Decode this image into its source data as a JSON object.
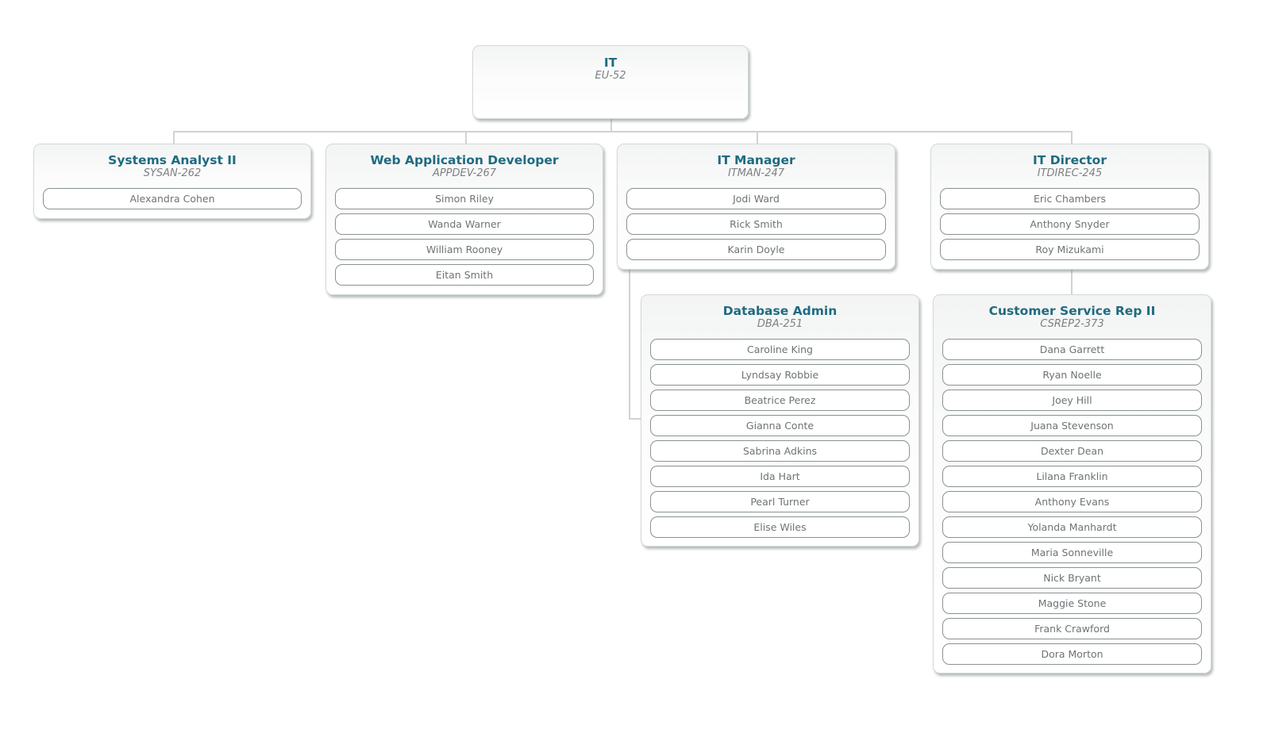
{
  "root": {
    "title": "IT",
    "code": "EU-52"
  },
  "positions": [
    {
      "title": "Systems Analyst II",
      "code": "SYSAN-262",
      "people": [
        "Alexandra Cohen"
      ]
    },
    {
      "title": "Web Application Developer",
      "code": "APPDEV-267",
      "people": [
        "Simon Riley",
        "Wanda Warner",
        "William Rooney",
        "Eitan Smith"
      ]
    },
    {
      "title": "IT Manager",
      "code": "ITMAN-247",
      "people": [
        "Jodi Ward",
        "Rick Smith",
        "Karin Doyle"
      ]
    },
    {
      "title": "IT Director",
      "code": "ITDIREC-245",
      "people": [
        "Eric Chambers",
        "Anthony Snyder",
        "Roy Mizukami"
      ]
    },
    {
      "title": "Database Admin",
      "code": "DBA-251",
      "reports_to": "IT Manager",
      "people": [
        "Caroline King",
        "Lyndsay Robbie",
        "Beatrice Perez",
        "Gianna Conte",
        "Sabrina Adkins",
        "Ida Hart",
        "Pearl Turner",
        "Elise Wiles"
      ]
    },
    {
      "title": "Customer Service Rep II",
      "code": "CSREP2-373",
      "reports_to": "IT Director",
      "people": [
        "Dana Garrett",
        "Ryan Noelle",
        "Joey Hill",
        "Juana Stevenson",
        "Dexter Dean",
        "Lilana Franklin",
        "Anthony Evans",
        "Yolanda Manhardt",
        "Maria Sonneville",
        "Nick Bryant",
        "Maggie Stone",
        "Frank Crawford",
        "Dora Morton"
      ]
    }
  ]
}
